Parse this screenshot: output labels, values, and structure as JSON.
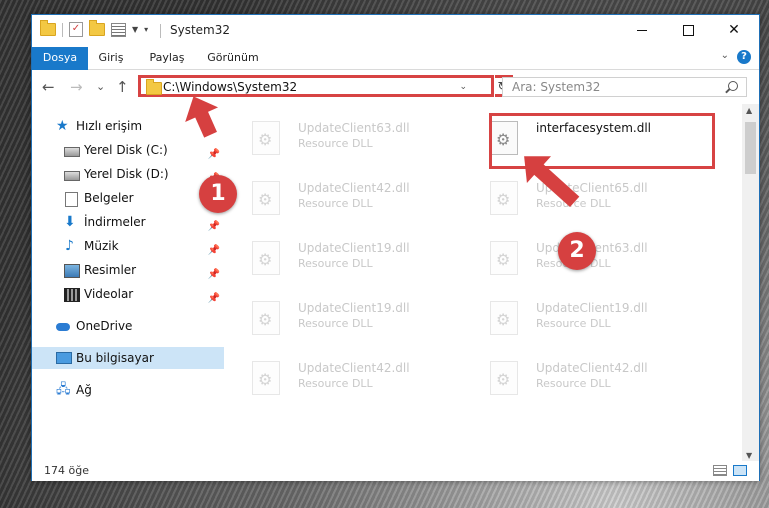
{
  "window": {
    "title": "System32",
    "controls": {
      "minimize": "",
      "maximize": "",
      "close": "✕"
    }
  },
  "ribbon": {
    "tabs": [
      {
        "label": "Dosya"
      },
      {
        "label": "Giriş"
      },
      {
        "label": "Paylaş"
      },
      {
        "label": "Görünüm"
      }
    ],
    "help": "?"
  },
  "nav": {
    "back": "←",
    "forward": "→",
    "recent": "⌄",
    "up": "↑",
    "address": "C:\\Windows\\System32",
    "refresh": "↻",
    "search_placeholder": "Ara: System32"
  },
  "sidebar": {
    "items": [
      {
        "label": "Hızlı erişim",
        "icon": "star-icon"
      },
      {
        "label": "Yerel Disk (C:)",
        "icon": "drive-icon",
        "pinned": true
      },
      {
        "label": "Yerel Disk (D:)",
        "icon": "drive-icon",
        "pinned": true
      },
      {
        "label": "Belgeler",
        "icon": "document-icon",
        "pinned": true
      },
      {
        "label": "İndirmeler",
        "icon": "download-icon",
        "pinned": true
      },
      {
        "label": "Müzik",
        "icon": "music-icon",
        "pinned": true
      },
      {
        "label": "Resimler",
        "icon": "pictures-icon",
        "pinned": true
      },
      {
        "label": "Videolar",
        "icon": "videos-icon",
        "pinned": true
      },
      {
        "label": "OneDrive",
        "icon": "cloud-icon"
      },
      {
        "label": "Bu bilgisayar",
        "icon": "computer-icon",
        "selected": true
      },
      {
        "label": "Ağ",
        "icon": "network-icon"
      }
    ]
  },
  "files": [
    {
      "name": "UpdateClient63.dll",
      "type": "Resource DLL",
      "faded": true
    },
    {
      "name": "interfacesystem.dll",
      "type": "",
      "faded": false,
      "highlighted": true
    },
    {
      "name": "UpdateClient42.dll",
      "type": "Resource DLL",
      "faded": true
    },
    {
      "name": "UpdateClient65.dll",
      "type": "Resource DLL",
      "faded": true
    },
    {
      "name": "UpdateClient19.dll",
      "type": "Resource DLL",
      "faded": true
    },
    {
      "name": "UpdateClient63.dll",
      "type": "Resource DLL",
      "faded": true
    },
    {
      "name": "UpdateClient19.dll",
      "type": "Resource DLL",
      "faded": true
    },
    {
      "name": "UpdateClient19.dll",
      "type": "Resource DLL",
      "faded": true
    },
    {
      "name": "UpdateClient42.dll",
      "type": "Resource DLL",
      "faded": true
    },
    {
      "name": "UpdateClient42.dll",
      "type": "Resource DLL",
      "faded": true
    }
  ],
  "status": {
    "count": "174 öğe"
  },
  "annotations": {
    "step1": "1",
    "step2": "2"
  },
  "colors": {
    "accent": "#1979ca",
    "annotation": "#d64040"
  }
}
